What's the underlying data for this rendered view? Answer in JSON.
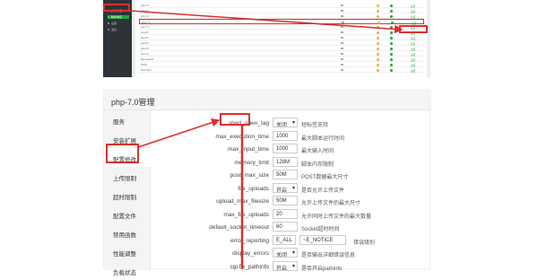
{
  "sidebar": {
    "items": [
      {
        "label": "文件管理",
        "active": false
      },
      {
        "label": "软件商店",
        "active": true
      },
      {
        "label": "设置",
        "active": false
      },
      {
        "label": "退出",
        "active": false
      }
    ]
  },
  "software_list": {
    "rows": [
      {
        "name": "php-7.0",
        "highlight": false
      },
      {
        "name": "php-7.1",
        "highlight": false
      },
      {
        "name": "php-7.2",
        "highlight": false
      },
      {
        "name": "php-7.3",
        "highlight": true
      },
      {
        "name": "php-7.4",
        "highlight": false
      },
      {
        "name": "php-8.0",
        "highlight": false
      },
      {
        "name": "php-8.1",
        "highlight": false
      },
      {
        "name": "php-8.2",
        "highlight": false
      },
      {
        "name": "php-5.6",
        "highlight": false
      },
      {
        "name": "php-5.4",
        "highlight": false
      },
      {
        "name": "Memcached",
        "highlight": false
      },
      {
        "name": "Redis",
        "highlight": false
      },
      {
        "name": "Pure-Ftpd",
        "highlight": false
      }
    ],
    "action": "设置"
  },
  "php_config": {
    "title": "php-7.0管理",
    "menu": [
      {
        "label": "服务",
        "active": false
      },
      {
        "label": "安装扩展",
        "active": false
      },
      {
        "label": "配置修改",
        "active": true
      },
      {
        "label": "上传限制",
        "active": false
      },
      {
        "label": "超时限制",
        "active": false
      },
      {
        "label": "配置文件",
        "active": false
      },
      {
        "label": "禁用函数",
        "active": false
      },
      {
        "label": "性能调整",
        "active": false
      },
      {
        "label": "负载状态",
        "active": false
      }
    ],
    "fields": [
      {
        "label": "short_open_tag",
        "value": "关闭",
        "type": "select",
        "desc": "短标签支持"
      },
      {
        "label": "max_execution_time",
        "value": "1000",
        "type": "input",
        "desc": "最大脚本运行时间"
      },
      {
        "label": "max_input_time",
        "value": "1000",
        "type": "input",
        "desc": "最大输入时间"
      },
      {
        "label": "memory_limit",
        "value": "128M",
        "type": "input",
        "desc": "脚本内存限制"
      },
      {
        "label": "post_max_size",
        "value": "50M",
        "type": "input",
        "desc": "POST数据最大尺寸"
      },
      {
        "label": "file_uploads",
        "value": "开启",
        "type": "select",
        "desc": "是否允许上传文件"
      },
      {
        "label": "upload_max_filesize",
        "value": "50M",
        "type": "input",
        "desc": "允许上传文件的最大尺寸"
      },
      {
        "label": "max_file_uploads",
        "value": "20",
        "type": "input",
        "desc": "允许同时上传文件的最大数量"
      },
      {
        "label": "default_socket_timeout",
        "value": "60",
        "type": "input",
        "desc": "Socket超时时间"
      },
      {
        "label": "error_reporting",
        "value": "E_ALL",
        "value2": "~E_NOTICE",
        "type": "double",
        "desc": "错误级别"
      },
      {
        "label": "display_errors",
        "value": "关闭",
        "type": "select",
        "desc": "是否输出详细错误信息"
      },
      {
        "label": "cgi.fix_pathinfo",
        "value": "开启",
        "type": "select",
        "desc": "是否开启pathinfo"
      }
    ]
  }
}
